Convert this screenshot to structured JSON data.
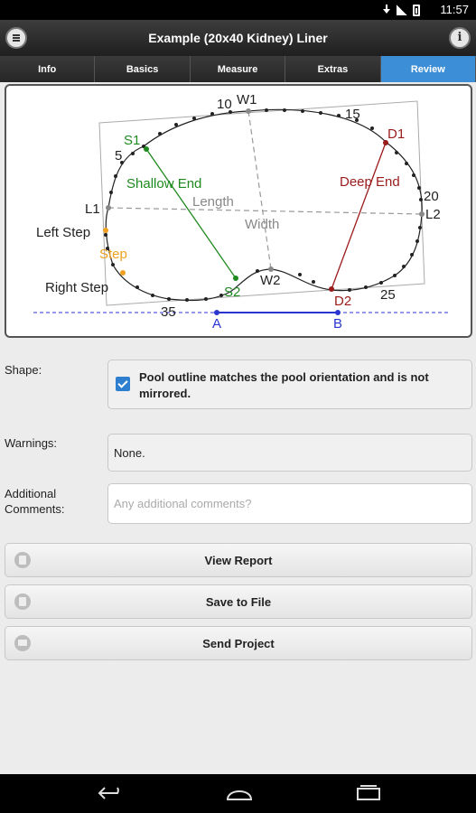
{
  "status_bar": {
    "time": "11:57"
  },
  "app_bar": {
    "title": "Example (20x40 Kidney) Liner"
  },
  "tabs": [
    {
      "label": "Info"
    },
    {
      "label": "Basics"
    },
    {
      "label": "Measure"
    },
    {
      "label": "Extras"
    },
    {
      "label": "Review"
    }
  ],
  "active_tab": "Review",
  "diagram": {
    "labels": {
      "w1": "W1",
      "w2": "W2",
      "s1": "S1",
      "s2": "S2",
      "d1": "D1",
      "d2": "D2",
      "l1": "L1",
      "l2": "L2",
      "n5": "5",
      "n10": "10",
      "n15": "15",
      "n20": "20",
      "n25": "25",
      "n35": "35",
      "shallow_end": "Shallow End",
      "deep_end": "Deep End",
      "length": "Length",
      "width": "Width",
      "left_step": "Left Step",
      "step": "Step",
      "right_step": "Right Step",
      "a": "A",
      "b": "B"
    },
    "colors": {
      "outline": "#222222",
      "shallow": "#1f8a1f",
      "deep": "#9b1b1b",
      "step": "#f0a020",
      "baseline": "#2a35d0",
      "guide": "#999999"
    }
  },
  "shape": {
    "label": "Shape:",
    "checked": true,
    "text": "Pool outline matches the pool orientation and is not mirrored."
  },
  "warnings": {
    "label": "Warnings:",
    "value": "None."
  },
  "comments": {
    "label": "Additional Comments:",
    "placeholder": "Any additional comments?"
  },
  "buttons": {
    "view_report": "View Report",
    "save_to_file": "Save to File",
    "send_project": "Send Project"
  },
  "icons": {
    "menu": "menu-icon",
    "info": "info-icon",
    "report": "document-icon",
    "save": "save-icon",
    "send": "mail-icon"
  }
}
